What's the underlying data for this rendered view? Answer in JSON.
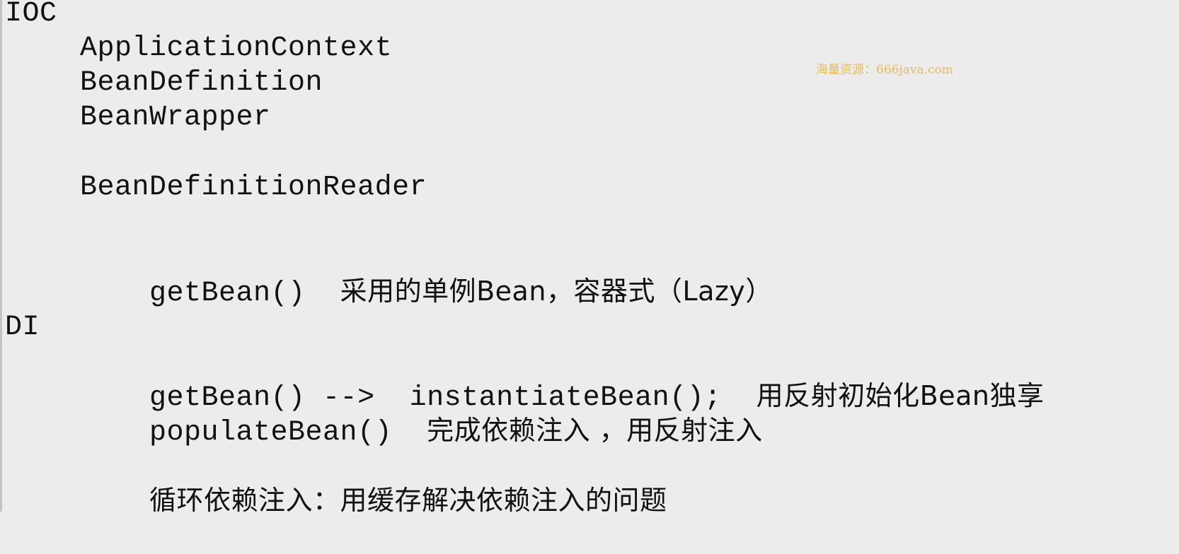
{
  "ioc": {
    "heading": "IOC",
    "items": [
      "ApplicationContext",
      "BeanDefinition",
      "BeanWrapper",
      "BeanDefinitionReader"
    ],
    "getbean_code": "getBean()",
    "getbean_note": "采用的单例Bean，容器式（Lazy）"
  },
  "watermark": "海量资源：666java.com",
  "di": {
    "heading": "DI",
    "line1_code": "getBean() -->  instantiateBean();",
    "line1_note": "用反射初始化Bean独享",
    "line2_code": "populateBean()",
    "line2_note": "完成依赖注入 ，用反射注入",
    "circular_note": "循环依赖注入：用缓存解决依赖注入的问题"
  }
}
